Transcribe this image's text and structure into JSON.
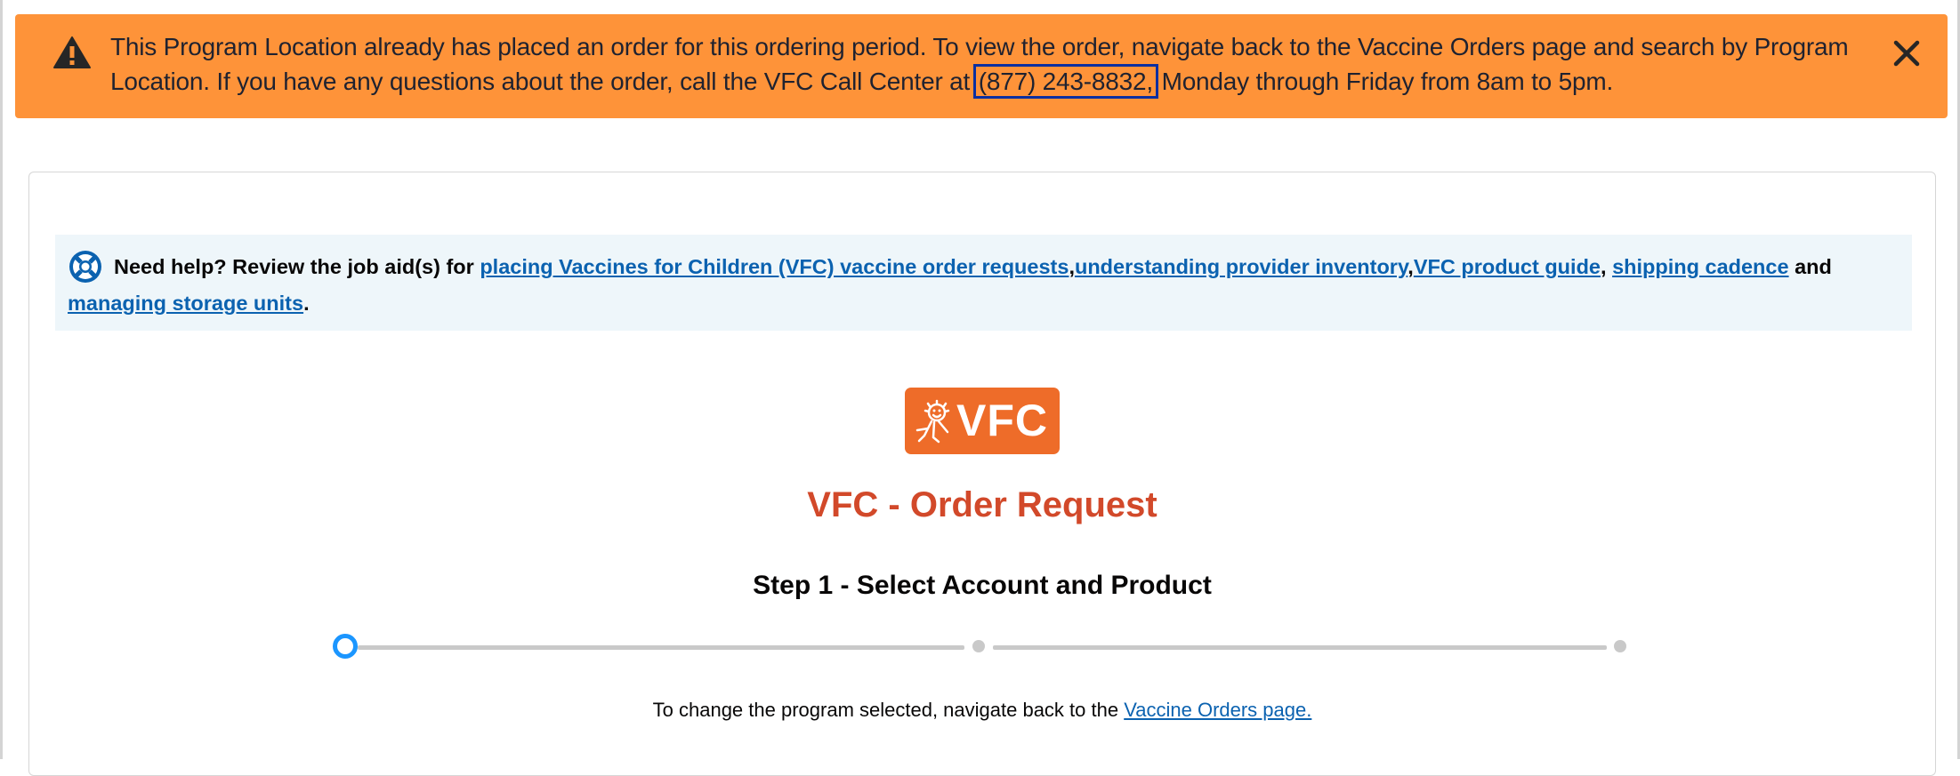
{
  "toast": {
    "message_part1": "This Program Location already has placed an order for this ordering period. To view the order, navigate back to the Vaccine Orders page and search by Program Location. If you have any questions about the order, call the VFC Call Center at ",
    "phone": "(877) 243-8832,",
    "message_part2": " Monday through Friday from 8am to 5pm.",
    "icon": "warning-icon",
    "close_icon": "close-icon",
    "background_color": "#fe9339"
  },
  "help": {
    "icon": "lifebuoy-icon",
    "intro": "Need help? Review the job aid(s) for ",
    "link1": "placing Vaccines for Children (VFC) vaccine order requests",
    "sep1": ",",
    "link2": "understanding provider inventory",
    "sep2": ",",
    "link3": "VFC product guide",
    "sep3": ", ",
    "link4": "shipping cadence",
    "and": " and ",
    "link5": "managing storage units",
    "end": "."
  },
  "logo": {
    "text": "VFC",
    "background_color": "#ee6c29"
  },
  "page_title": "VFC - Order Request",
  "step_title": "Step 1 - Select Account and Product",
  "stepper": {
    "current_step": 1,
    "total_steps": 3,
    "active_color": "#1b96ff"
  },
  "change_note": {
    "text": "To change the program selected, navigate back to the ",
    "link": "Vaccine Orders page."
  }
}
